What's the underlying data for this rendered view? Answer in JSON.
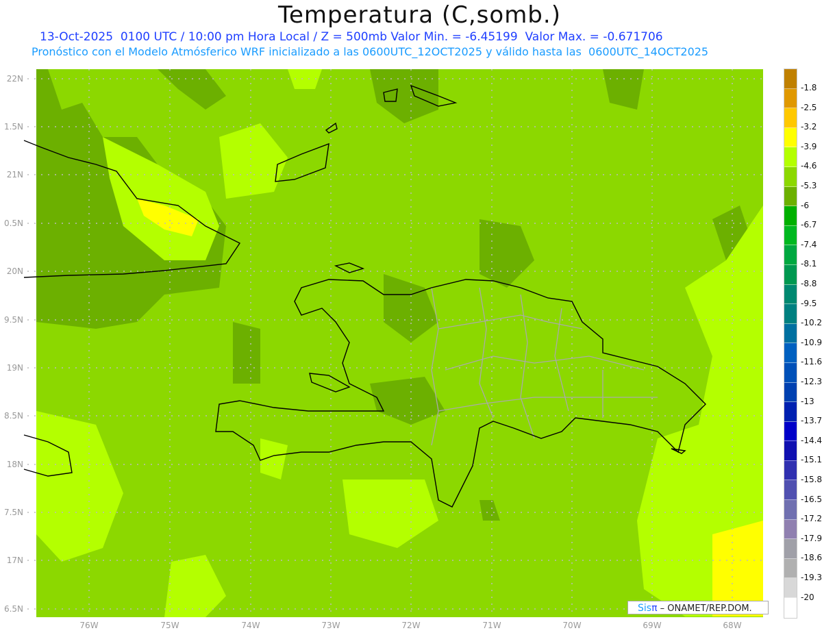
{
  "title": "Temperatura (C,somb.)",
  "subtitle_line1": "13-Oct-2025  0100 UTC / 10:00 pm Hora Local / Z = 500mb Valor Min. = -6.45199  Valor Max. = -0.671706",
  "subtitle_line2": "Pronóstico con el Modelo Atmósferico WRF inicializado a las 0600UTC_12OCT2025 y válido hasta las  0600UTC_14OCT2025",
  "lat_labels": [
    "22N",
    "1.5N",
    "21N",
    "0.5N",
    "20N",
    "9.5N",
    "19N",
    "8.5N",
    "18N",
    "7.5N",
    "17N",
    "6.5N"
  ],
  "lon_labels": [
    "76W",
    "75W",
    "74W",
    "73W",
    "72W",
    "71W",
    "70W",
    "69W",
    "68W"
  ],
  "colorbar": {
    "labels": [
      "-1.8",
      "-2.5",
      "-3.2",
      "-3.9",
      "-4.6",
      "-5.3",
      "-6",
      "-6.7",
      "-7.4",
      "-8.1",
      "-8.8",
      "-9.5",
      "-10.2",
      "-10.9",
      "-11.6",
      "-12.3",
      "-13",
      "-13.7",
      "-14.4",
      "-15.1",
      "-15.8",
      "-16.5",
      "-17.2",
      "-17.9",
      "-18.6",
      "-19.3",
      "-20"
    ],
    "colors": [
      "#c08000",
      "#e09800",
      "#ffc800",
      "#ffff00",
      "#b4ff00",
      "#8cd800",
      "#6cb000",
      "#00b000",
      "#00b820",
      "#00a840",
      "#009850",
      "#008870",
      "#008080",
      "#0070a0",
      "#0060c0",
      "#0050b8",
      "#0040b0",
      "#0020b0",
      "#0000c8",
      "#1010b0",
      "#3030b0",
      "#5050b0",
      "#7070b0",
      "#9080b0",
      "#a0a0a8",
      "#b0b0b0",
      "#d8d8d8",
      "#ffffff"
    ]
  },
  "credit": {
    "sis": "Sis",
    "pi": "π",
    "rest": "–  ONAMET/REP.DOM."
  }
}
